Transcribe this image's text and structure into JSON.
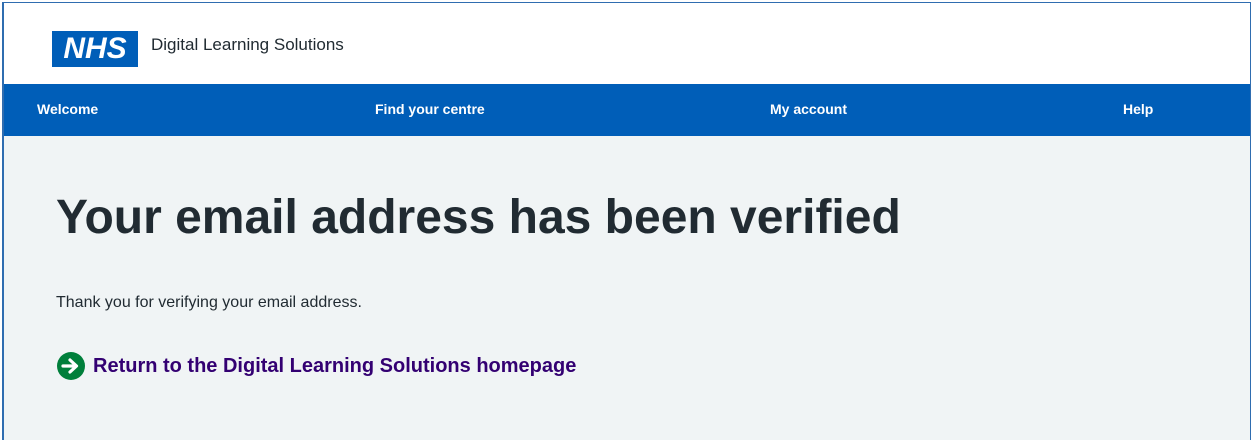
{
  "header": {
    "logo_text": "NHS",
    "service_name": "Digital Learning Solutions"
  },
  "nav": {
    "items": [
      {
        "label": "Welcome"
      },
      {
        "label": "Find your centre"
      },
      {
        "label": "My account"
      },
      {
        "label": "Help"
      }
    ]
  },
  "main": {
    "title": "Your email address has been verified",
    "body": "Thank you for verifying your email address.",
    "return_link": {
      "label": "Return to the Digital Learning Solutions homepage",
      "icon": "arrow-right-circle-icon"
    }
  },
  "colors": {
    "brand_blue": "#005eb8",
    "background": "#f0f4f5",
    "text": "#212b32",
    "link": "#330072",
    "arrow_green": "#007f3b"
  }
}
